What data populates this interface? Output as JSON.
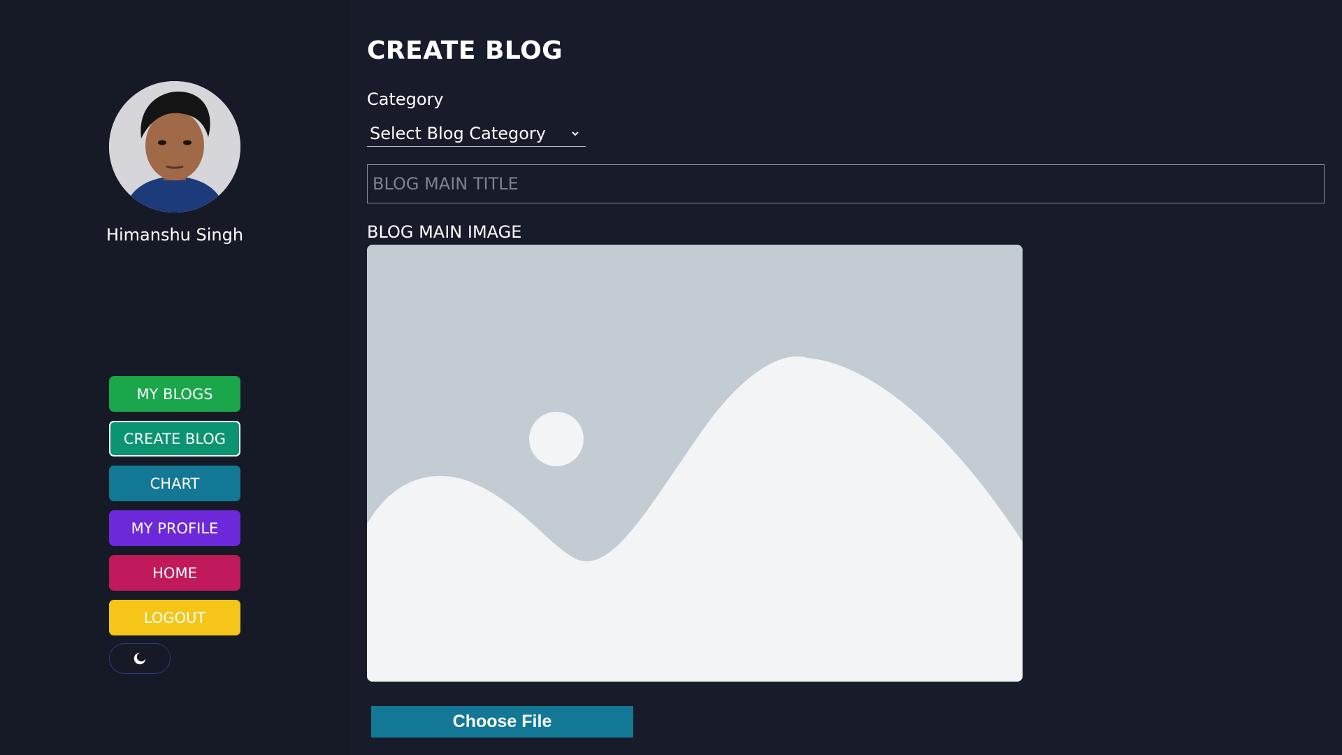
{
  "sidebar": {
    "user_name": "Himanshu Singh",
    "nav": [
      {
        "label": "MY BLOGS",
        "color": "#1aa64a"
      },
      {
        "label": "CREATE BLOG",
        "color": "#0b9470"
      },
      {
        "label": "CHART",
        "color": "#137895"
      },
      {
        "label": "MY PROFILE",
        "color": "#6d28d9"
      },
      {
        "label": "HOME",
        "color": "#c01a5a"
      },
      {
        "label": "LOGOUT",
        "color": "#f5c518"
      }
    ],
    "active_item": "CREATE BLOG",
    "theme_toggle_icon": "moon-icon"
  },
  "main": {
    "title": "CREATE BLOG",
    "category_label": "Category",
    "category_selected": "Select Blog Category",
    "title_placeholder": "BLOG MAIN TITLE",
    "image_label": "BLOG MAIN IMAGE",
    "image_icon": "image-placeholder-icon",
    "choose_file_label": "Choose File"
  },
  "colors": {
    "background": "#181b2a",
    "sidebar_background": "#161a27",
    "placeholder_bg": "#c3cbd3",
    "placeholder_fg": "#f2f4f6",
    "file_button": "#137895"
  }
}
